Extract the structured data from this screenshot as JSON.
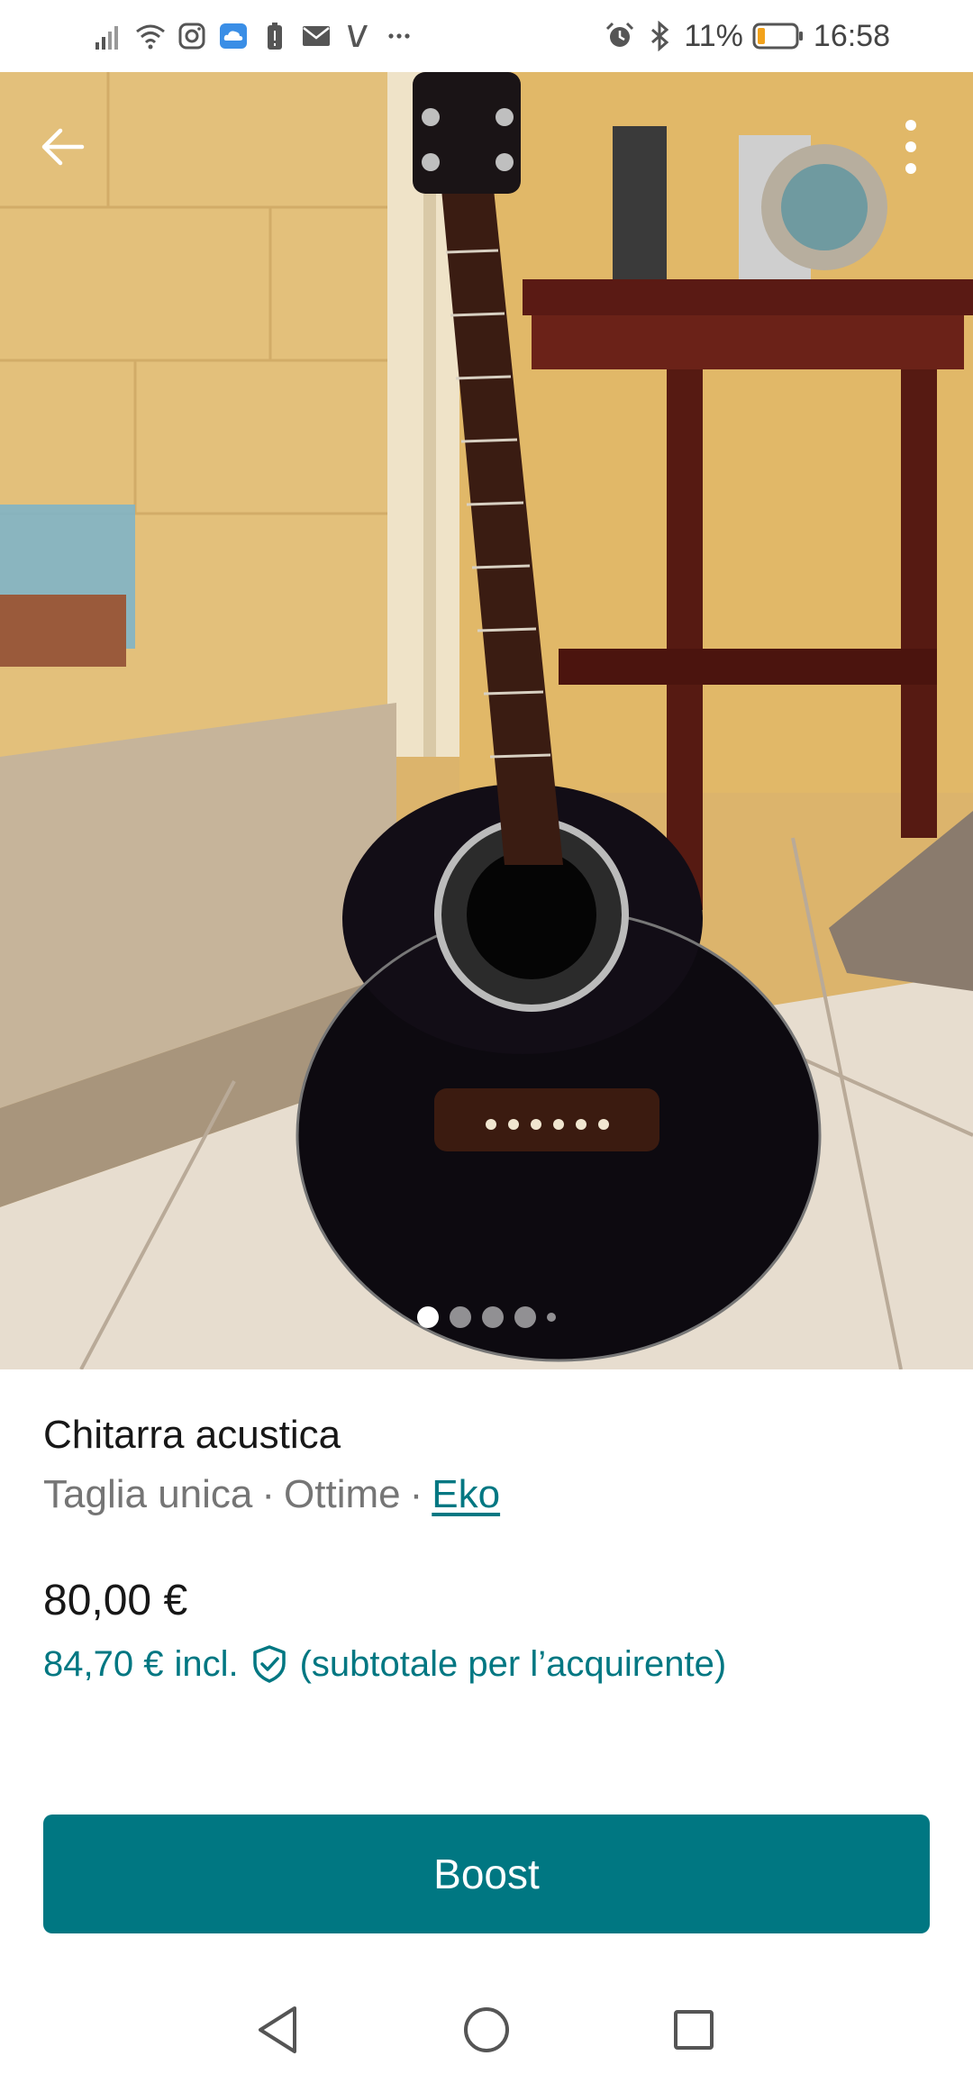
{
  "status_bar": {
    "battery_percent": "11%",
    "time": "16:58",
    "left_icons": [
      "signal-icon",
      "wifi-icon",
      "instagram-icon",
      "cloud-icon",
      "battery-saver-icon",
      "mail-icon",
      "v-app-icon",
      "more-notifications-icon"
    ],
    "right_icons": [
      "alarm-icon",
      "bluetooth-icon",
      "battery-icon"
    ]
  },
  "gallery": {
    "photo_count": 5,
    "active_index": 0,
    "subject": "guitar-photo"
  },
  "item": {
    "title": "Chitarra acustica",
    "size": "Taglia unica",
    "separator": "·",
    "condition": "Ottime",
    "brand": "Eko",
    "price": "80,00 €",
    "price_incl": "84,70 €",
    "incl_label": "incl.",
    "buyer_note": "(subtotale per l’acquirente)"
  },
  "actions": {
    "boost_label": "Boost"
  },
  "colors": {
    "accent": "#007782",
    "text": "#171717",
    "muted": "#757575"
  }
}
